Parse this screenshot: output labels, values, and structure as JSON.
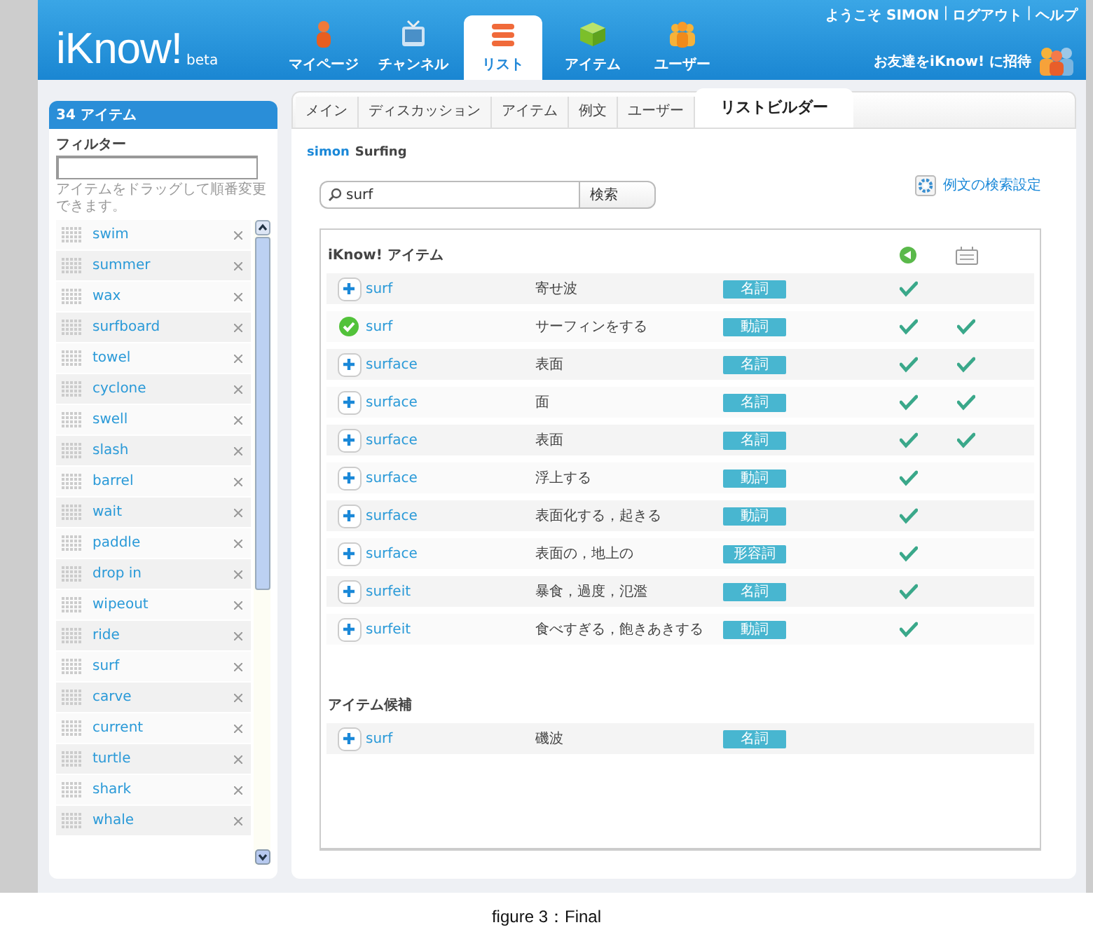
{
  "header": {
    "logo": "iKnow!",
    "beta": "beta",
    "nav": [
      {
        "label": "マイページ",
        "selected": false
      },
      {
        "label": "チャンネル",
        "selected": false
      },
      {
        "label": "リスト",
        "selected": true
      },
      {
        "label": "アイテム",
        "selected": false
      },
      {
        "label": "ユーザー",
        "selected": false
      }
    ],
    "user_links": [
      {
        "kind": "text",
        "text": "ようこそ SIMON"
      },
      {
        "kind": "separator",
        "text": "|"
      },
      {
        "kind": "link",
        "text": "ログアウト"
      },
      {
        "kind": "separator",
        "text": "|"
      },
      {
        "kind": "link",
        "text": "ヘルプ"
      }
    ],
    "invite": "お友達をiKnow! に招待"
  },
  "sidebar": {
    "title": "34 アイテム",
    "filter_label": "フィルター",
    "hint": "アイテムをドラッグして順番変更できます。",
    "items": [
      "swim",
      "summer",
      "wax",
      "surfboard",
      "towel",
      "cyclone",
      "swell",
      "slash",
      "barrel",
      "wait",
      "paddle",
      "drop in",
      "wipeout",
      "ride",
      "surf",
      "carve",
      "current",
      "turtle",
      "shark",
      "whale"
    ]
  },
  "tabs": [
    {
      "label": "メイン",
      "selected": false
    },
    {
      "label": "ディスカッション",
      "selected": false
    },
    {
      "label": "アイテム",
      "selected": false
    },
    {
      "label": "例文",
      "selected": false
    },
    {
      "label": "ユーザー",
      "selected": false
    },
    {
      "label": "リストビルダー",
      "selected": true
    }
  ],
  "breadcrumb": {
    "user": "simon",
    "list": "Surfing"
  },
  "search": {
    "value": "surf",
    "button": "検索"
  },
  "settings_link": "例文の検索設定",
  "sections": [
    {
      "title": "iKnow! アイテム",
      "column_icons": true,
      "rows": [
        {
          "word": "surf",
          "meaning": "寄せ波",
          "pos": "名詞",
          "added": false,
          "audio": true,
          "sentences": false
        },
        {
          "word": "surf",
          "meaning": "サーフィンをする",
          "pos": "動詞",
          "added": true,
          "audio": true,
          "sentences": true
        },
        {
          "word": "surface",
          "meaning": "表面",
          "pos": "名詞",
          "added": false,
          "audio": true,
          "sentences": true
        },
        {
          "word": "surface",
          "meaning": "面",
          "pos": "名詞",
          "added": false,
          "audio": true,
          "sentences": true
        },
        {
          "word": "surface",
          "meaning": "表面",
          "pos": "名詞",
          "added": false,
          "audio": true,
          "sentences": true
        },
        {
          "word": "surface",
          "meaning": "浮上する",
          "pos": "動詞",
          "added": false,
          "audio": true,
          "sentences": false
        },
        {
          "word": "surface",
          "meaning": "表面化する，起きる",
          "pos": "動詞",
          "added": false,
          "audio": true,
          "sentences": false
        },
        {
          "word": "surface",
          "meaning": "表面の，地上の",
          "pos": "形容詞",
          "added": false,
          "audio": true,
          "sentences": false
        },
        {
          "word": "surfeit",
          "meaning": "暴食，過度，氾濫",
          "pos": "名詞",
          "added": false,
          "audio": true,
          "sentences": false
        },
        {
          "word": "surfeit",
          "meaning": "食べすぎる，飽きあきする",
          "pos": "動詞",
          "added": false,
          "audio": true,
          "sentences": false
        }
      ]
    },
    {
      "title": "アイテム候補",
      "column_icons": false,
      "rows": [
        {
          "word": "surf",
          "meaning": "磯波",
          "pos": "名詞",
          "added": false,
          "audio": false,
          "sentences": false
        }
      ]
    }
  ],
  "caption": "figure 3：Final"
}
